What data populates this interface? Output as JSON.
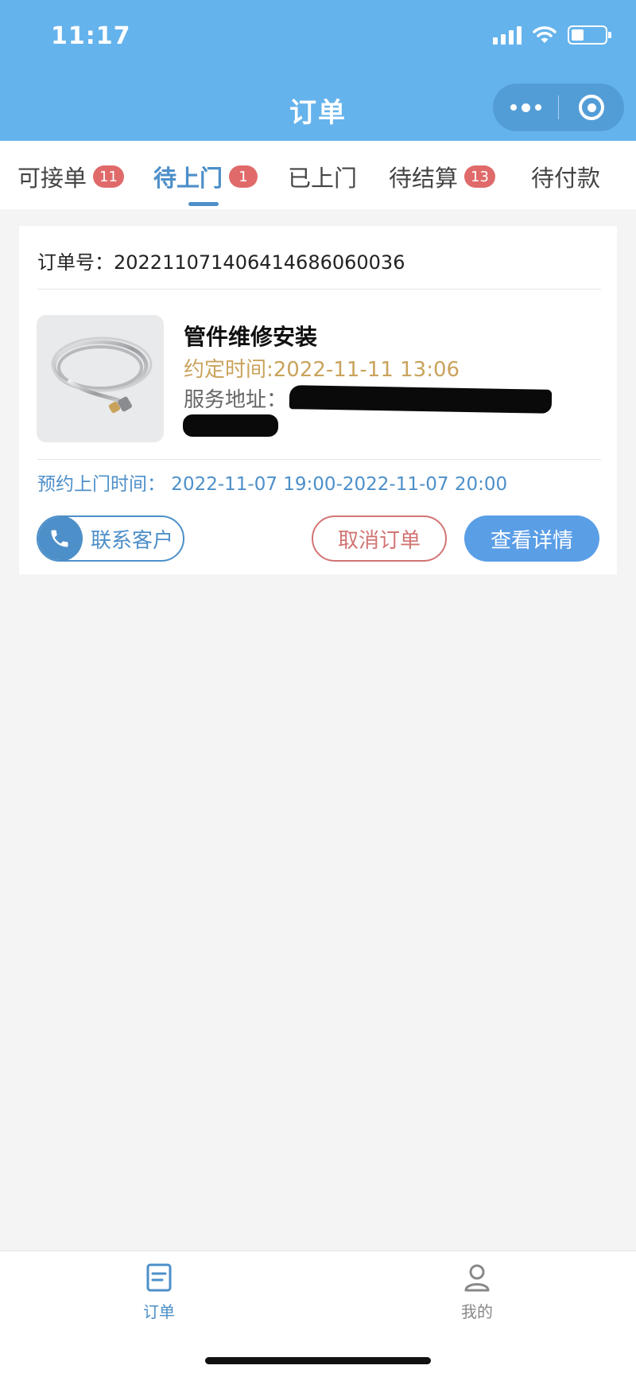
{
  "status_bar": {
    "time": "11:17"
  },
  "nav": {
    "title": "订单"
  },
  "tabs": [
    {
      "label": "可接单",
      "badge": "11"
    },
    {
      "label": "待上门",
      "badge": "1"
    },
    {
      "label": "已上门",
      "badge": ""
    },
    {
      "label": "待结算",
      "badge": "13"
    },
    {
      "label": "待付款",
      "badge": ""
    }
  ],
  "active_tab": "待上门",
  "order": {
    "order_no_label": "订单号：",
    "order_no": "20221107140641468606003​6",
    "service_name": "管件维修安装",
    "appointed_time": "约定时间:2022-11-11 13:06",
    "address_label": "服务地址：",
    "visit_time": "预约上门时间：  2022-11-07 19:00-2022-11-07 20:00",
    "contact_button": "联系客户",
    "cancel_button": "取消订单",
    "detail_button": "查看详情"
  },
  "bottom_nav": [
    {
      "label": "订单",
      "icon": "order-doc-icon",
      "active": true
    },
    {
      "label": "我的",
      "icon": "person-icon",
      "active": false
    }
  ],
  "colors": {
    "header_bg": "#65b3ec",
    "accent": "#4d8fc9",
    "badge": "#e06a6a",
    "appointed_time": "#c9a35c",
    "cancel": "#d27474",
    "primary_button": "#5a9ee6"
  }
}
